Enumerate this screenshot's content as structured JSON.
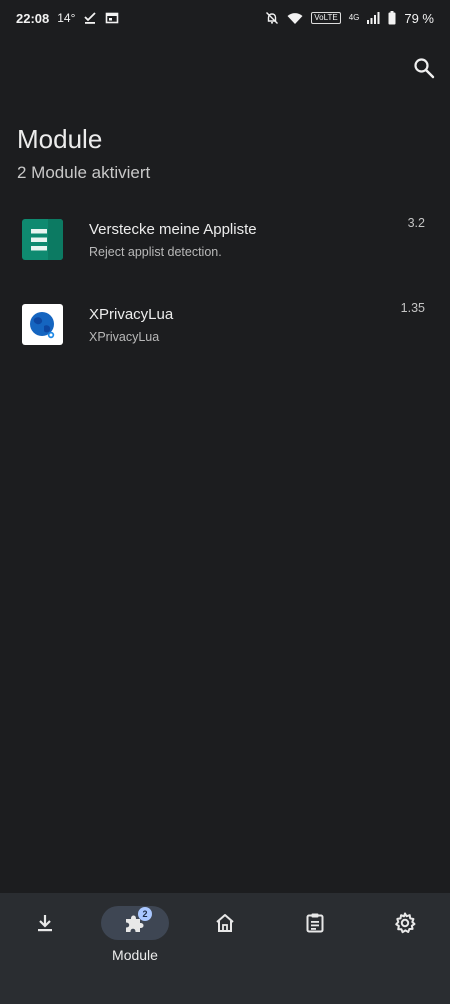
{
  "status_bar": {
    "time": "22:08",
    "temperature": "14°",
    "network_label": "VoLTE",
    "network_type": "4G",
    "battery": "79 %"
  },
  "header": {
    "title": "Module",
    "subtitle": "2 Module aktiviert"
  },
  "modules": [
    {
      "name": "Verstecke meine Appliste",
      "description": "Reject applist detection.",
      "version": "3.2",
      "icon": "hide-my-applist-icon",
      "icon_color": "#0f8a70"
    },
    {
      "name": "XPrivacyLua",
      "description": "XPrivacyLua",
      "version": "1.35",
      "icon": "xprivacylua-icon",
      "icon_color": "#1565c0"
    }
  ],
  "bottom_nav": {
    "items": [
      {
        "icon": "download-icon",
        "label": ""
      },
      {
        "icon": "puzzle-icon",
        "label": "Module",
        "badge": "2",
        "active": true
      },
      {
        "icon": "home-icon",
        "label": ""
      },
      {
        "icon": "clipboard-icon",
        "label": ""
      },
      {
        "icon": "gear-icon",
        "label": ""
      }
    ]
  },
  "colors": {
    "background": "#1c1d1f",
    "nav_background": "#2a2d31",
    "active_pill": "#3e4653",
    "badge": "#a9c7ff"
  }
}
